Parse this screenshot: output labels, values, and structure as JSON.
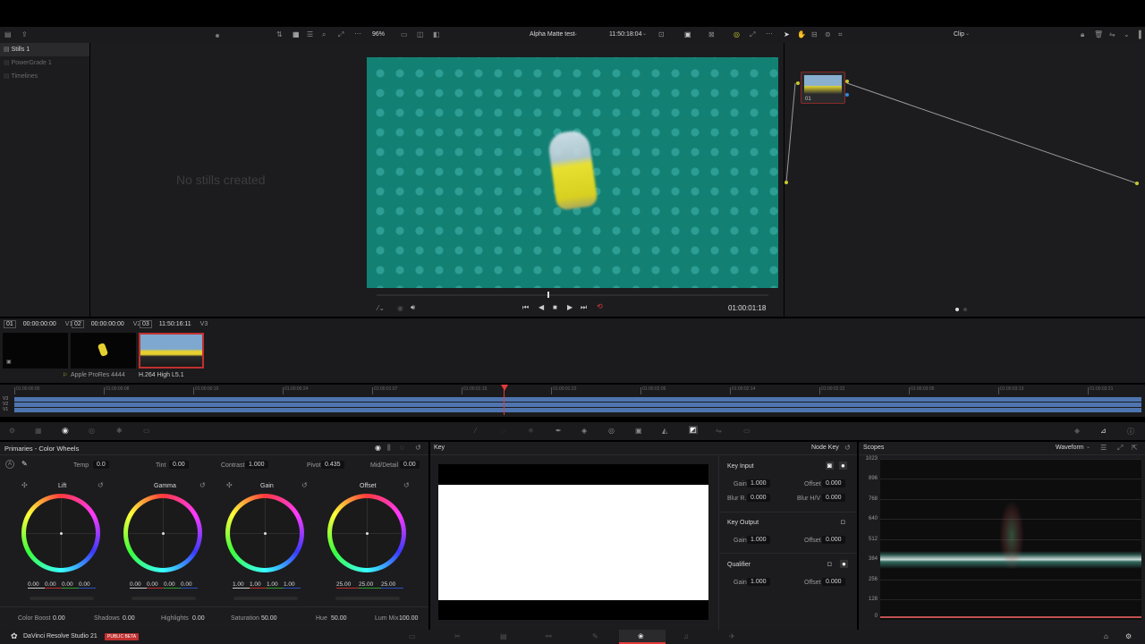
{
  "toolbar": {
    "zoom": "96%",
    "clip_name": "Alpha Matte test",
    "timecode": "11:50:18:04",
    "node_mode": "Clip"
  },
  "gallery": {
    "items": [
      "Stills 1",
      "PowerGrade 1",
      "Timelines"
    ],
    "empty_text": "No stills created"
  },
  "viewer": {
    "timecode": "01:00:01:18"
  },
  "clips": {
    "headers": [
      {
        "num": "01",
        "tc": "00:00:00:00",
        "track": "V1"
      },
      {
        "num": "02",
        "tc": "00:00:00:00",
        "track": "V2"
      },
      {
        "num": "03",
        "tc": "11:50:16:11",
        "track": "V3"
      }
    ],
    "labels": [
      "Apple ProRes 4444",
      "H.264 High L5.1"
    ]
  },
  "mini_timeline": {
    "ticks": [
      "01:00:00:00",
      "01:00:00:08",
      "01:00:00:16",
      "01:00:00:24",
      "01:00:01:07",
      "01:00:01:15",
      "01:00:01:23",
      "01:00:02:06",
      "01:00:02:14",
      "01:00:02:22",
      "01:00:03:05",
      "01:00:03:13",
      "01:00:03:21"
    ],
    "tracks": [
      "V3",
      "V2",
      "V1"
    ]
  },
  "primaries": {
    "title": "Primaries - Color Wheels",
    "top_params": [
      {
        "label": "Temp",
        "value": "0.0"
      },
      {
        "label": "Tint",
        "value": "0.00"
      },
      {
        "label": "Contrast",
        "value": "1.000"
      },
      {
        "label": "Pivot",
        "value": "0.435"
      },
      {
        "label": "Mid/Detail",
        "value": "0.00"
      }
    ],
    "wheels": [
      {
        "name": "Lift",
        "values": [
          "0.00",
          "0.00",
          "0.00",
          "0.00"
        ]
      },
      {
        "name": "Gamma",
        "values": [
          "0.00",
          "0.00",
          "0.00",
          "0.00"
        ]
      },
      {
        "name": "Gain",
        "values": [
          "1.00",
          "1.00",
          "1.00",
          "1.00"
        ]
      },
      {
        "name": "Offset",
        "values": [
          "25.00",
          "25.00",
          "25.00"
        ]
      }
    ],
    "bottom_params": [
      {
        "label": "Color Boost",
        "value": "0.00"
      },
      {
        "label": "Shadows",
        "value": "0.00"
      },
      {
        "label": "Highlights",
        "value": "0.00"
      },
      {
        "label": "Saturation",
        "value": "50.00"
      },
      {
        "label": "Hue",
        "value": "50.00"
      },
      {
        "label": "Lum Mix",
        "value": "100.00"
      }
    ]
  },
  "key": {
    "title": "Key",
    "node_key": "Node Key",
    "input_title": "Key Input",
    "output_title": "Key Output",
    "qualifier_title": "Qualifier",
    "gain_label": "Gain",
    "offset_label": "Offset",
    "blur_r_label": "Blur R.",
    "blur_hv_label": "Blur H/V",
    "input_gain": "1.000",
    "input_offset": "0.000",
    "blur_r": "0.000",
    "blur_hv": "0.000",
    "output_gain": "1.000",
    "output_offset": "0.000",
    "qual_gain": "1.000",
    "qual_offset": "0.000"
  },
  "scopes": {
    "title": "Scopes",
    "mode": "Waveform",
    "scale": [
      "1023",
      "896",
      "768",
      "640",
      "512",
      "384",
      "256",
      "128",
      "0"
    ]
  },
  "nodes": {
    "node_label": "01"
  },
  "footer": {
    "app_name": "DaVinci Resolve Studio 21",
    "badge": "PUBLIC BETA"
  }
}
